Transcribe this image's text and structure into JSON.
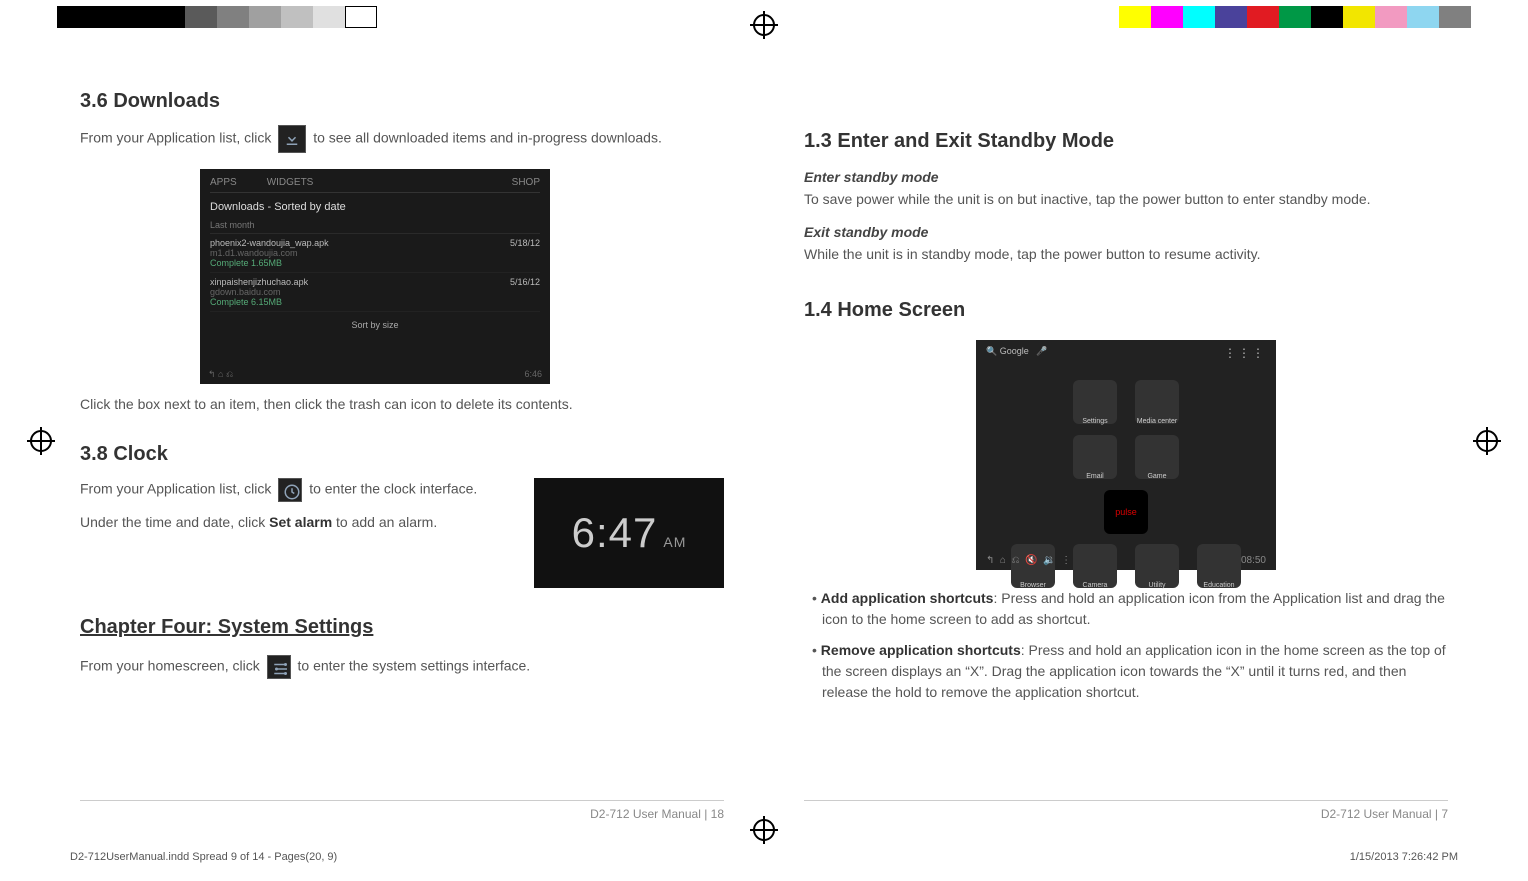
{
  "left": {
    "sec36_title": "3.6 Downloads",
    "sec36_p1_a": "From your Application list, click ",
    "sec36_p1_b": " to see all downloaded items and in-progress downloads.",
    "sec36_p2": "Click the box next to an item, then click the trash can icon to delete its contents.",
    "sec38_title": "3.8 Clock",
    "sec38_p1_a": "From your Application list, click ",
    "sec38_p1_b": " to enter the clock interface.",
    "sec38_p2_a": "Under the time and date, click ",
    "sec38_p2_bold": "Set alarm",
    "sec38_p2_b": " to add an alarm.",
    "clock_time": "6:47",
    "clock_ampm": "AM",
    "chapter_title": "Chapter Four: System Settings",
    "ch4_p1_a": "From your homescreen, click ",
    "ch4_p1_b": " to enter the system settings interface.",
    "footer": "D2-712 User Manual | 18",
    "dl": {
      "tab_apps": "APPS",
      "tab_widgets": "WIDGETS",
      "shop": "SHOP",
      "heading": "Downloads - Sorted by date",
      "section": "Last month",
      "row1_name": "phoenix2-wandoujia_wap.apk",
      "row1_host": "m1.d1.wandoujia.com",
      "row1_status": "Complete   1.65MB",
      "row1_date": "5/18/12",
      "row2_name": "xinpaishenjizhuchao.apk",
      "row2_host": "gdown.baidu.com",
      "row2_status": "Complete   6.15MB",
      "row2_date": "5/16/12",
      "sort": "Sort by size",
      "time": "6:46"
    }
  },
  "right": {
    "sec13_title": "1.3 Enter and Exit Standby Mode",
    "enter_h": "Enter standby mode",
    "enter_p": "To save power while the unit is on but inactive, tap the power button to enter standby mode.",
    "exit_h": "Exit standby mode",
    "exit_p": "While the unit is in standby mode, tap the power button to resume activity.",
    "sec14_title": "1.4 Home Screen",
    "home": {
      "search": "Google",
      "apps": [
        "Settings",
        "Media center",
        "Email",
        "Game",
        "Browser",
        "Camera",
        "Utility",
        "Education"
      ],
      "pulse": "pulse",
      "time": "08:50"
    },
    "bullet1_label": "Add application shortcuts",
    "bullet1_text": ": Press and hold an application icon from the Application list and drag the icon to the home screen to add as shortcut.",
    "bullet2_label": "Remove application shortcuts",
    "bullet2_text": ": Press and hold an application icon in the home screen as the top of the screen displays an “X”. Drag the application icon towards the “X” until it turns red, and then release the hold to remove the application shortcut.",
    "footer": "D2-712 User Manual | 7"
  },
  "print": {
    "file": "D2-712UserManual.indd   Spread 9 of 14 - Pages(20, 9)",
    "timestamp": "1/15/2013   7:26:42 PM"
  },
  "colorbars": {
    "left": [
      "#000000",
      "#000000",
      "#000000",
      "#000000",
      "#5a5a5a",
      "#808080",
      "#a0a0a0",
      "#c0c0c0",
      "#e0e0e0",
      "#ffffff"
    ],
    "right": [
      "#ffff00",
      "#ff00ff",
      "#00ffff",
      "#4a429b",
      "#e11b22",
      "#009846",
      "#000000",
      "#f2e600",
      "#f29ac1",
      "#8ed6f0",
      "#808080"
    ]
  }
}
